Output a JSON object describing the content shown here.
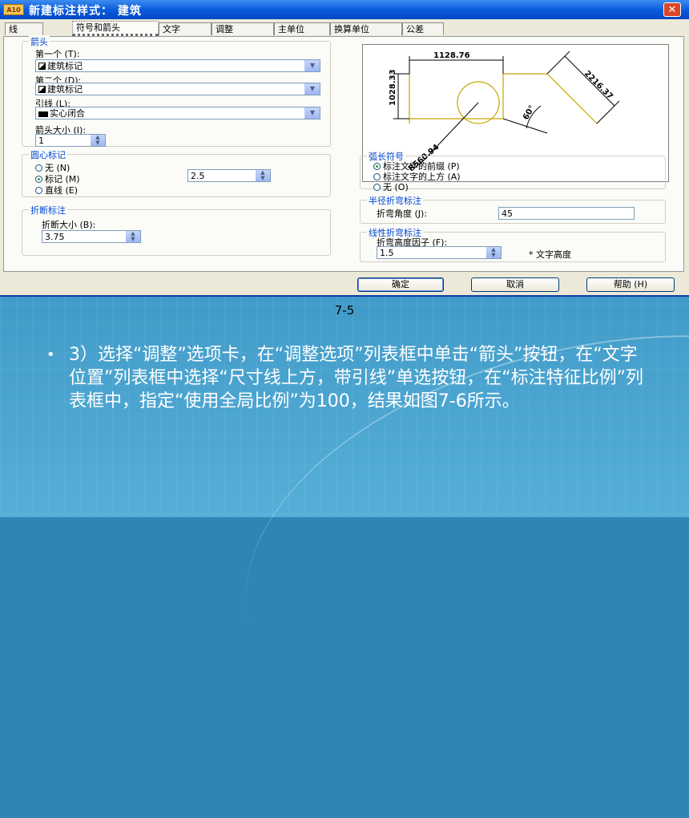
{
  "window": {
    "title": "新建标注样式：  建筑",
    "icon": "A10",
    "close": "✕"
  },
  "tabs": [
    "线",
    "符号和箭头",
    "文字",
    "调整",
    "主单位",
    "换算单位",
    "公差"
  ],
  "arrows": {
    "group": "箭头",
    "first_label": "第一个 (T):",
    "first_value": "建筑标记",
    "second_label": "第二个 (D):",
    "second_value": "建筑标记",
    "leader_label": "引线 (L):",
    "leader_value": "实心闭合",
    "size_label": "箭头大小 (I):",
    "size_value": "1"
  },
  "center_mark": {
    "group": "圆心标记",
    "options": [
      "无 (N)",
      "标记 (M)",
      "直线 (E)"
    ],
    "selected": 1,
    "size_value": "2.5"
  },
  "break": {
    "group": "折断标注",
    "size_label": "折断大小 (B):",
    "size_value": "3.75"
  },
  "preview": {
    "dim_top": "1128.76",
    "dim_left": "1028.33",
    "dim_right": "2216.37",
    "dim_bottom": "R560.94",
    "angle": "60°"
  },
  "arc_symbol": {
    "group": "弧长符号",
    "options": [
      "标注文字的前缀 (P)",
      "标注文字的上方 (A)",
      "无 (O)"
    ],
    "selected": 0
  },
  "radius_jog": {
    "group": "半径折弯标注",
    "angle_label": "折弯角度 (J):",
    "angle_value": "45"
  },
  "linear_jog": {
    "group": "线性折弯标注",
    "factor_label": "折弯高度因子 (F):",
    "factor_value": "1.5",
    "suffix": "* 文字高度"
  },
  "buttons": {
    "ok": "确定",
    "cancel": "取消",
    "help": "帮助 (H)"
  },
  "slide": {
    "caption": "7-5",
    "bullet": "•",
    "text": "3）选择“调整”选项卡，在“调整选项”列表框中单击“箭头”按钮，在“文字位置”列表框中选择“尺寸线上方，带引线”单选按钮，在“标注特征比例”列表框中，指定“使用全局比例”为100，结果如图7-6所示。"
  },
  "colors": {
    "titlebar": "#0a5ddc",
    "legend": "#0046d5",
    "slide_bg": "#2f86b5",
    "preview_line": "#c8a400"
  }
}
